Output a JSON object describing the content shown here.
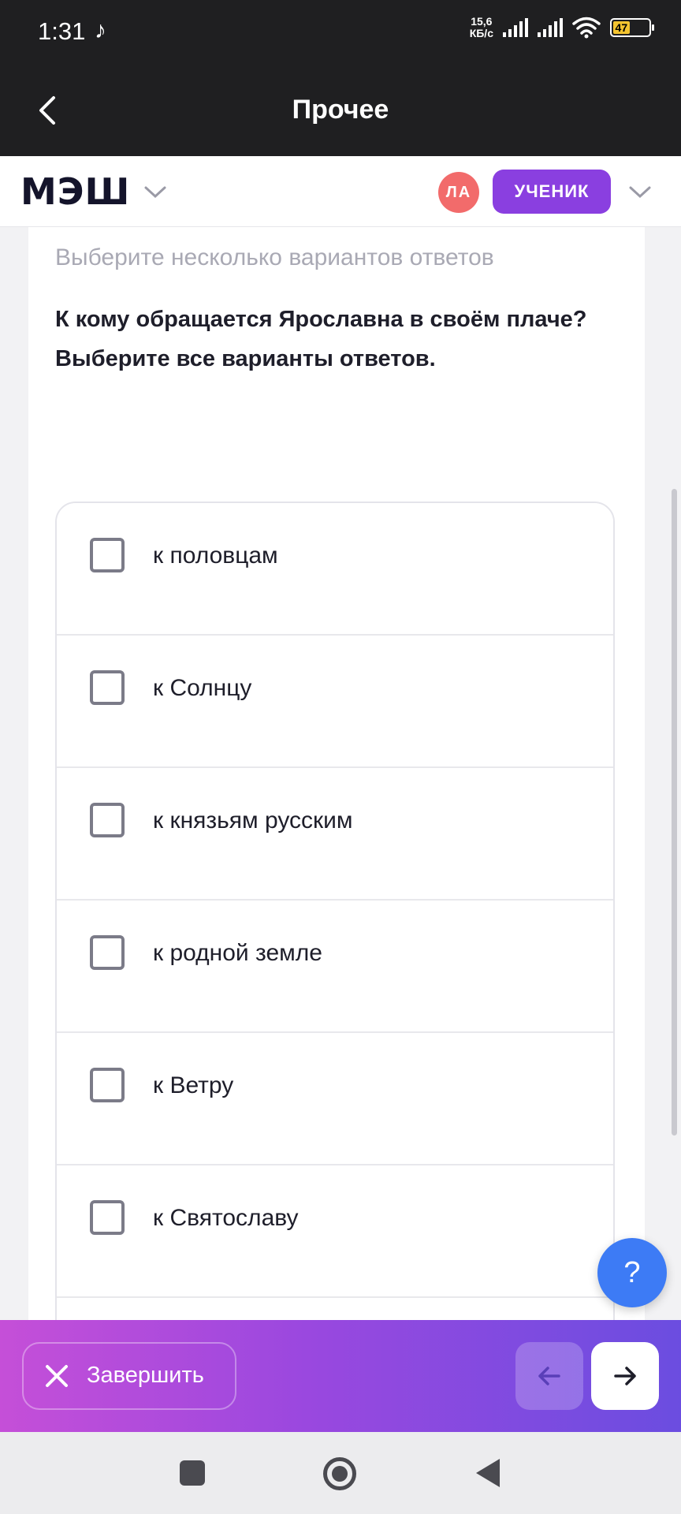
{
  "status_bar": {
    "time": "1:31",
    "tiktok_glyph": "♪",
    "speed_value": "15,6",
    "speed_unit": "КБ/с",
    "battery": "47",
    "battery_fill_fraction": 0.47
  },
  "app_bar": {
    "title": "Прочее"
  },
  "header": {
    "logo": "МЭШ",
    "avatar_initials": "ЛА",
    "role_label": "УЧЕНИК"
  },
  "task": {
    "hint": "Выберите несколько вариантов ответов",
    "question": "К кому обращается Ярославна в своём плаче? Выберите все варианты ответов.",
    "options": [
      {
        "label": "к половцам",
        "checked": false
      },
      {
        "label": "к Солнцу",
        "checked": false
      },
      {
        "label": "к князьям русским",
        "checked": false
      },
      {
        "label": "к родной земле",
        "checked": false
      },
      {
        "label": "к Ветру",
        "checked": false
      },
      {
        "label": "к Святославу",
        "checked": false
      }
    ]
  },
  "help": {
    "label": "?"
  },
  "actions": {
    "finish_label": "Завершить"
  },
  "colors": {
    "accent_purple": "#8a3fe0",
    "avatar_red": "#f26b6b",
    "help_blue": "#3d7bf5"
  }
}
